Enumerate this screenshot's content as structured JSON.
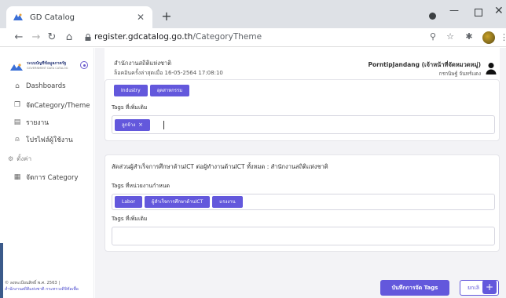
{
  "browser": {
    "tab_title": "GD Catalog",
    "new_tab": "+",
    "url_domain": "register.gdcatalog.go.th",
    "url_path": "/CategoryTheme"
  },
  "sidebar": {
    "logo_line1": "ระบบบัญชีข้อมูลภาครัฐ",
    "logo_line2": "GOVERNMENT DATA CATALOG",
    "items": [
      {
        "label": "Dashboards",
        "icon": "home-icon"
      },
      {
        "label": "จัดCategory/Theme",
        "icon": "folders-icon"
      },
      {
        "label": "รายงาน",
        "icon": "document-icon"
      },
      {
        "label": "โปรไฟล์ผู้ใช้งาน",
        "icon": "user-icon"
      }
    ],
    "section_label": "ตั้งค่า",
    "section_items": [
      {
        "label": "จัดการ Category",
        "icon": "grid-icon"
      }
    ],
    "footer_line1": "© ลงทะเบียนสิทธิ์ พ.ศ. 2563 |",
    "footer_line2": "สำนักงานสถิติแห่งชาติ กระทรวงดิจิทัลเพื่อ"
  },
  "header": {
    "org_name": "สำนักงานสถิติแห่งชาติ",
    "last_login": "ล็อคอินครั้งล่าสุดเมื่อ 16-05-2564 17:08:10",
    "user_name": "PorntipJandang (เจ้าหน้าที่จัดหมวดหมู่)",
    "user_role": "กรกนิษฐ์ จันทร์แดง"
  },
  "card1": {
    "chips": [
      "Industry",
      "อุตสาหกรรม"
    ],
    "extra_tags_label": "Tags ที่เพิ่มเติม",
    "extra_chips": [
      "ลูกจ้าง"
    ],
    "chip_remove": "×"
  },
  "card2": {
    "title": "สัดส่วนผู้สำเร็จการศึกษาด้านICT ต่อผู้ทำงานด้านICT ทั้งหมด : สำนักงานสถิติแห่งชาติ",
    "agency_tags_label": "Tags ที่หน่วยงานกำหนด",
    "agency_chips": [
      "Labor",
      "ผู้สำเร็จการศึกษาด้านICT",
      "แรงงาน"
    ],
    "extra_tags_label": "Tags ที่เพิ่มเติม"
  },
  "actions": {
    "save_label": "บันทึกการจัด Tags",
    "cancel_label": "ยกเลิ",
    "fab_label": "+"
  },
  "colors": {
    "accent": "#6358dc",
    "background": "#f3f3f6"
  }
}
